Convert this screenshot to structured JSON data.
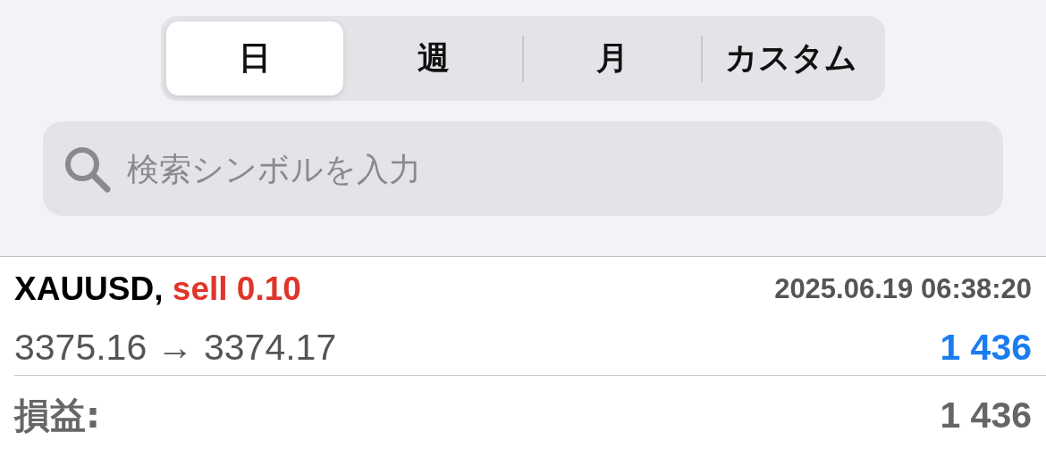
{
  "tabs": [
    {
      "label": "日",
      "selected": true
    },
    {
      "label": "週",
      "selected": false
    },
    {
      "label": "月",
      "selected": false
    },
    {
      "label": "カスタム",
      "selected": false
    }
  ],
  "search": {
    "placeholder": "検索シンボルを入力"
  },
  "trade": {
    "symbol": "XAUUSD,",
    "order": "sell 0.10",
    "time": "2025.06.19 06:38:20",
    "prices": "3375.16 → 3374.17",
    "profit": "1 436"
  },
  "total": {
    "label": "損益:",
    "value": "1 436"
  }
}
